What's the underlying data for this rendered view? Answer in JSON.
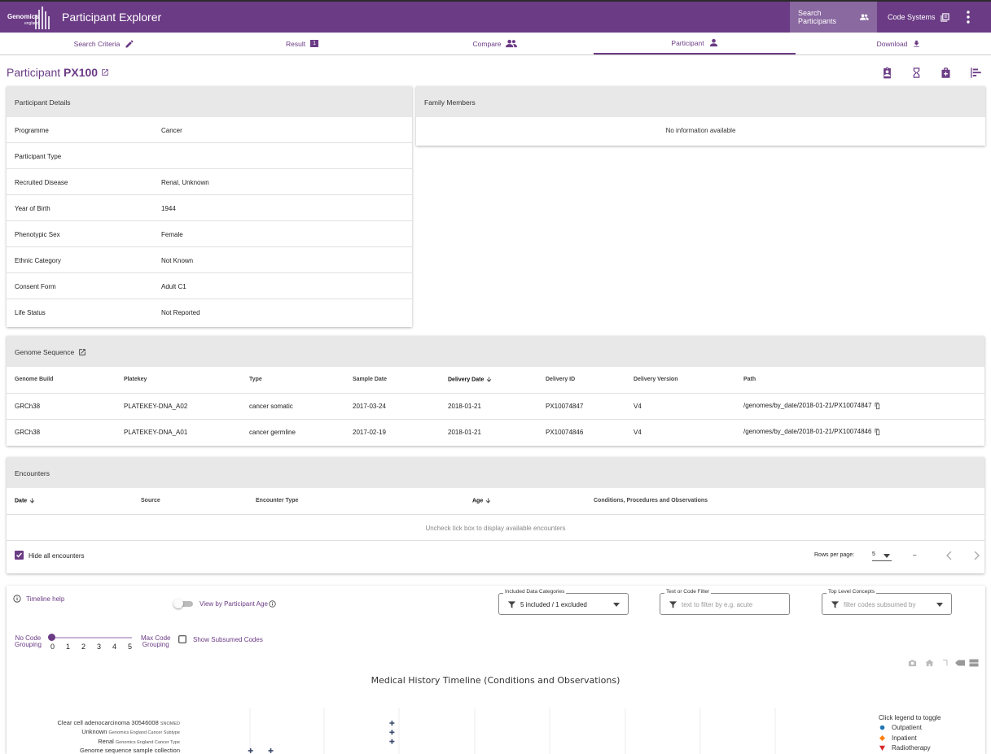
{
  "app": {
    "logo_line1": "Genomics",
    "logo_line2": "england",
    "title": "Participant Explorer",
    "search_participants": "Search Participants",
    "code_systems": "Code Systems"
  },
  "tabs": [
    {
      "label": "Search Criteria"
    },
    {
      "label": "Result",
      "badge": "1"
    },
    {
      "label": "Compare"
    },
    {
      "label": "Participant"
    },
    {
      "label": "Download"
    }
  ],
  "participant": {
    "prefix": "Participant",
    "id": "PX100"
  },
  "details": {
    "header": "Participant Details",
    "rows": [
      {
        "k": "Programme",
        "v": "Cancer"
      },
      {
        "k": "Participant Type",
        "v": ""
      },
      {
        "k": "Recruited Disease",
        "v": "Renal, Unknown"
      },
      {
        "k": "Year of Birth",
        "v": "1944"
      },
      {
        "k": "Phenotypic Sex",
        "v": "Female"
      },
      {
        "k": "Ethnic Category",
        "v": "Not Known"
      },
      {
        "k": "Consent Form",
        "v": "Adult C1"
      },
      {
        "k": "Life Status",
        "v": "Not Reported"
      }
    ]
  },
  "family": {
    "header": "Family Members",
    "empty": "No information available"
  },
  "genome": {
    "header": "Genome Sequence",
    "columns": [
      "Genome Build",
      "Platekey",
      "Type",
      "Sample Date",
      "Delivery Date",
      "Delivery ID",
      "Delivery Version",
      "Path"
    ],
    "rows": [
      [
        "GRCh38",
        "PLATEKEY-DNA_A02",
        "cancer somatic",
        "2017-03-24",
        "2018-01-21",
        "PX10074847",
        "V4",
        "/genomes/by_date/2018-01-21/PX10074847"
      ],
      [
        "GRCh38",
        "PLATEKEY-DNA_A01",
        "cancer germline",
        "2017-02-19",
        "2018-01-21",
        "PX10074846",
        "V4",
        "/genomes/by_date/2018-01-21/PX10074846"
      ]
    ]
  },
  "encounters": {
    "header": "Encounters",
    "columns": [
      "Date",
      "Source",
      "Encounter Type",
      "Age",
      "Conditions, Procedures and Observations"
    ],
    "empty": "Uncheck tick box to display available encounters",
    "hide_label": "Hide all encounters",
    "rows_per_page_label": "Rows per page:",
    "rows_per_page": "5",
    "range": "–"
  },
  "timeline": {
    "help": "Timeline help",
    "view_by_age": "View by Participant Age",
    "included_label": "Included Data Categories",
    "included_value": "5 included / 1 excluded",
    "filter_label": "Text or Code Filter",
    "filter_placeholder": "text to filter by e.g. acute",
    "toplevel_label": "Top Level Concepts",
    "toplevel_placeholder": "filter codes subsumed by",
    "no_grouping_1": "No Code",
    "no_grouping_2": "Grouping",
    "max_grouping_1": "Max Code",
    "max_grouping_2": "Grouping",
    "slider_ticks": [
      "0",
      "1",
      "2",
      "3",
      "4",
      "5"
    ],
    "slider_value": 0,
    "show_subsumed": "Show Subsumed Codes"
  },
  "chart_data": {
    "type": "scatter",
    "title": "Medical History Timeline (Conditions and Observations)",
    "categories": [
      {
        "label": "Clear cell adenocarcinoma 30546008",
        "tag": "SNOMED"
      },
      {
        "label": "Unknown",
        "tag": "Genomics England Cancer Subtype"
      },
      {
        "label": "Renal",
        "tag": "Genomics England Cancer Type"
      },
      {
        "label": "Genome sequence sample collection",
        "tag": ""
      }
    ],
    "legend_title": "Click legend to toggle",
    "legend": [
      {
        "name": "Outpatient",
        "color": "#1f77b4",
        "symbol": "circle"
      },
      {
        "name": "Inpatient",
        "color": "#ff7f0e",
        "symbol": "diamond"
      },
      {
        "name": "Radiotherapy",
        "color": "#d62728",
        "symbol": "triangle-down"
      }
    ],
    "points": [
      {
        "row": 0,
        "x": 0.31
      },
      {
        "row": 1,
        "x": 0.31
      },
      {
        "row": 2,
        "x": 0.31
      },
      {
        "row": 3,
        "x": 0.1
      },
      {
        "row": 3,
        "x": 0.13
      }
    ],
    "legend_position": "right"
  },
  "colors": {
    "primary": "#6b3b85",
    "header_bg": "#e8e8e8"
  }
}
